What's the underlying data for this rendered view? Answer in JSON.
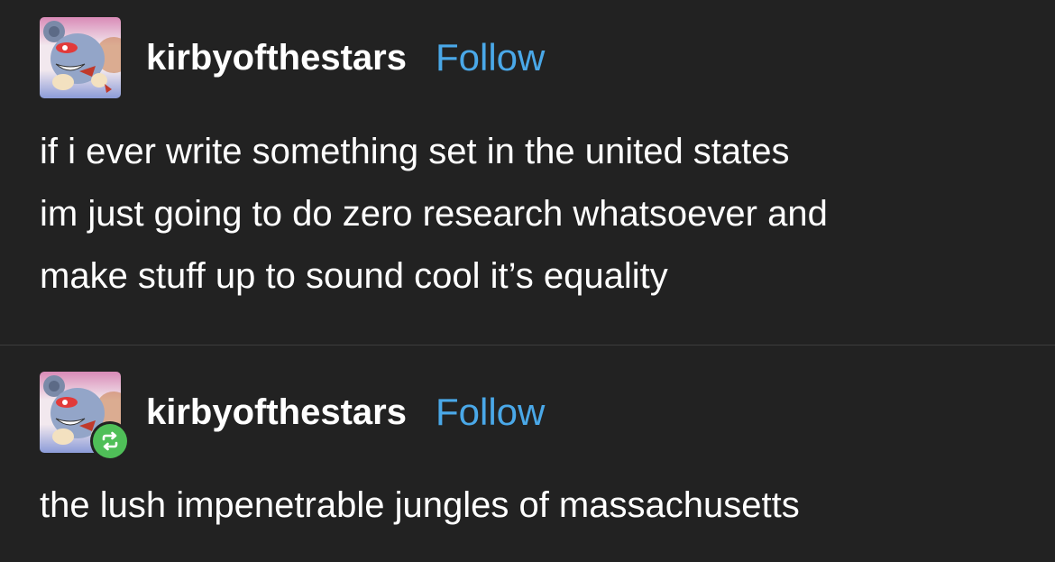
{
  "posts": [
    {
      "username": "kirbyofthestars",
      "follow_label": "Follow",
      "lines": [
        "if i ever write something set in the united states",
        "im just going to do zero research whatsoever and",
        "make stuff up to sound cool it’s equality"
      ],
      "reblog": false
    },
    {
      "username": "kirbyofthestars",
      "follow_label": "Follow",
      "lines": [
        "the lush impenetrable jungles of massachusetts"
      ],
      "reblog": true,
      "reblog_icon": "reblog-icon"
    }
  ],
  "colors": {
    "background": "#222222",
    "text": "#ffffff",
    "follow": "#4aa8e8",
    "reblog_badge": "#4fbf58",
    "divider": "#3c3c3c"
  }
}
